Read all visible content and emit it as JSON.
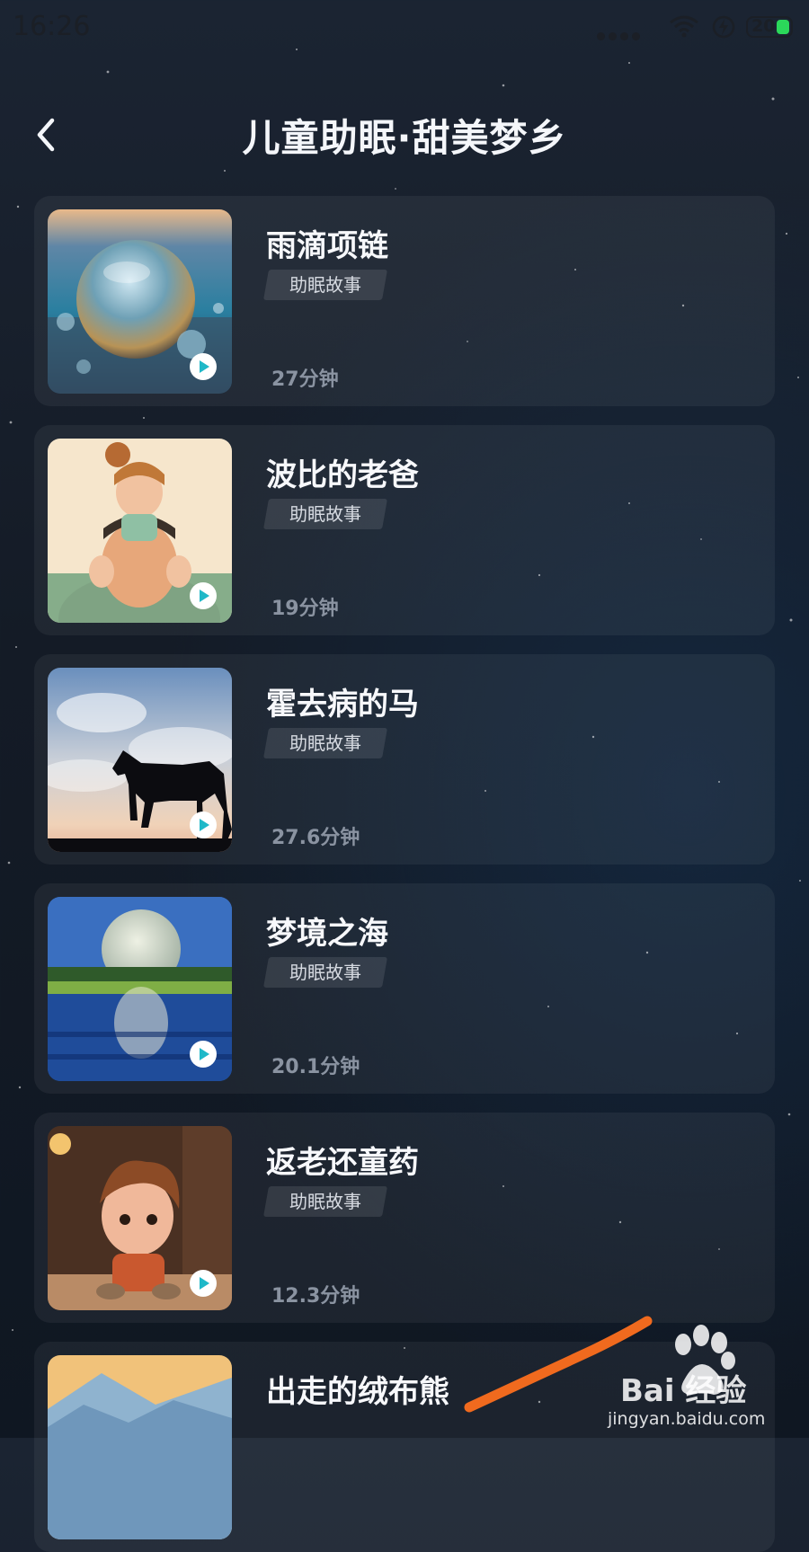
{
  "status_bar": {
    "time": "16:26",
    "battery": "20",
    "battery_color": "#2bd85a"
  },
  "header": {
    "title": "儿童助眠·甜美梦乡",
    "back_icon": "chevron-left-icon"
  },
  "stories": [
    {
      "title": "雨滴项链",
      "tag": "助眠故事",
      "duration": "27分钟"
    },
    {
      "title": "波比的老爸",
      "tag": "助眠故事",
      "duration": "19分钟"
    },
    {
      "title": "霍去病的马",
      "tag": "助眠故事",
      "duration": "27.6分钟"
    },
    {
      "title": "梦境之海",
      "tag": "助眠故事",
      "duration": "20.1分钟"
    },
    {
      "title": "返老还童药",
      "tag": "助眠故事",
      "duration": "12.3分钟"
    },
    {
      "title": "出走的绒布熊",
      "tag": "",
      "duration": ""
    }
  ],
  "watermark": {
    "brand": "Bai 经验",
    "url": "jingyan.baidu.com"
  },
  "colors": {
    "accent": "#1fb8c8",
    "annotation": "#f06a1e",
    "background": "#161e2a"
  }
}
